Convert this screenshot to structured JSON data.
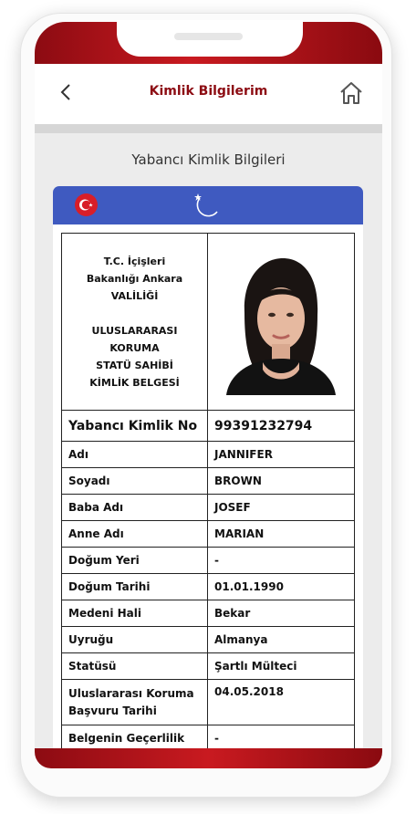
{
  "header": {
    "title": "Kimlik Bilgilerim",
    "back_icon": "chevron-left-icon",
    "home_icon": "home-icon"
  },
  "section_title": "Yabancı Kimlik Bilgileri",
  "banner": {
    "color": "#3f5ac0",
    "flag_icon": "turkey-flag-icon",
    "emblem_icon": "crescent-star-icon"
  },
  "card": {
    "authority_lines": [
      "T.C. İçişleri",
      "Bakanlığı Ankara",
      "VALİLİĞİ",
      "",
      "ULUSLARARASI",
      "KORUMA",
      "STATÜ SAHİBİ",
      "KİMLİK BELGESİ"
    ],
    "id_label": "Yabancı Kimlik No",
    "id_value": "99391232794",
    "rows": [
      {
        "label": "Adı",
        "value": "JANNIFER"
      },
      {
        "label": "Soyadı",
        "value": "BROWN"
      },
      {
        "label": "Baba Adı",
        "value": "JOSEF"
      },
      {
        "label": "Anne Adı",
        "value": "MARIAN"
      },
      {
        "label": "Doğum Yeri",
        "value": "-"
      },
      {
        "label": "Doğum Tarihi",
        "value": "01.01.1990"
      },
      {
        "label": "Medeni Hali",
        "value": "Bekar"
      },
      {
        "label": "Uyruğu",
        "value": "Almanya"
      },
      {
        "label": "Statüsü",
        "value": "Şartlı Mülteci"
      },
      {
        "label": "Uluslararası Koruma Başvuru Tarihi",
        "value": "04.05.2018"
      },
      {
        "label": "Belgenin Geçerlilik",
        "value": "-"
      }
    ]
  }
}
